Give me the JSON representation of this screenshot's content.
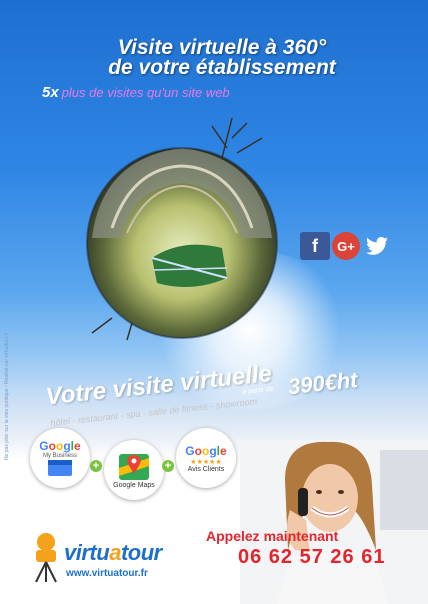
{
  "hero": {
    "title_line1": "Visite virtuelle à 360°",
    "title_line2": "de votre établissement",
    "multiplier": "5x",
    "subtitle": "plus de visites qu'un site web"
  },
  "vertical_note": "Ne pas jeter sur la voie publique - Réalisé par virtuatour.fr",
  "social": {
    "facebook": "f",
    "google_plus": "G+",
    "twitter": "🐦"
  },
  "offer": {
    "headline": "Votre visite virtuelle",
    "from_label": "à partir de",
    "price": "390€ht",
    "categories": "hôtel - restaurant - spa - salle de fitness - showroom"
  },
  "google_logos": [
    {
      "brand": "Google",
      "label": "My Business"
    },
    {
      "brand": "Google",
      "label": "Google Maps"
    },
    {
      "brand": "Google",
      "label": "Avis Clients",
      "stars": "★★★★★"
    }
  ],
  "contact": {
    "call_label": "Appelez maintenant",
    "phone": "06 62 57 26 61"
  },
  "brand": {
    "name_part1": "virtu",
    "name_o": "a",
    "name_part2": "tour",
    "url": "www.virtuatour.fr"
  },
  "colors": {
    "sky": "#2f86e4",
    "accent_red": "#e3262d",
    "brand_blue": "#1d6fcc",
    "subtitle_pink": "#e878e8"
  }
}
